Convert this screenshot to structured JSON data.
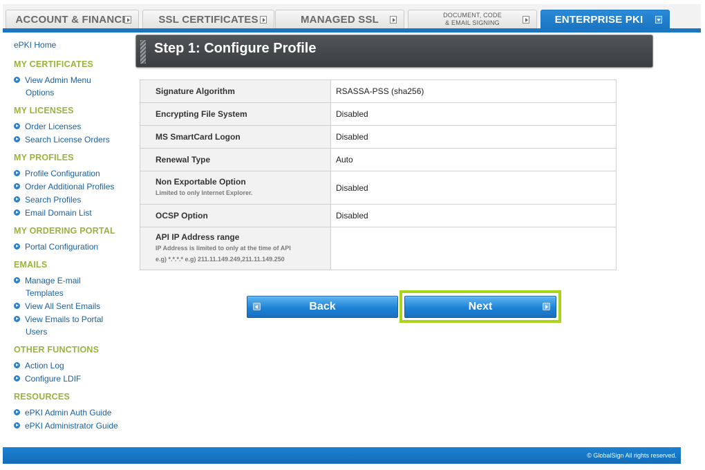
{
  "tabs": [
    {
      "label": "ACCOUNT & FINANCE",
      "active": false
    },
    {
      "label": "SSL CERTIFICATES",
      "active": false
    },
    {
      "label": "MANAGED SSL",
      "active": false
    },
    {
      "label_line1": "DOCUMENT, CODE",
      "label_line2": "& EMAIL SIGNING",
      "active": false
    },
    {
      "label": "ENTERPRISE PKI",
      "active": true
    }
  ],
  "sidebar": {
    "home": "ePKI Home",
    "sections": [
      {
        "title": "MY CERTIFICATES",
        "items": [
          {
            "l1": "View Admin Menu",
            "l2": "Options"
          }
        ]
      },
      {
        "title": "MY LICENSES",
        "items": [
          {
            "l1": "Order Licenses"
          },
          {
            "l1": "Search License Orders"
          }
        ]
      },
      {
        "title": "MY PROFILES",
        "items": [
          {
            "l1": "Profile Configuration"
          },
          {
            "l1": "Order Additional Profiles"
          },
          {
            "l1": "Search Profiles"
          },
          {
            "l1": "Email Domain List"
          }
        ]
      },
      {
        "title": "MY ORDERING PORTAL",
        "items": [
          {
            "l1": "Portal Configuration"
          }
        ]
      },
      {
        "title": "EMAILS",
        "items": [
          {
            "l1": "Manage E-mail",
            "l2": "Templates"
          },
          {
            "l1": "View All Sent Emails"
          },
          {
            "l1": "View Emails to Portal",
            "l2": "Users"
          }
        ]
      },
      {
        "title": "OTHER FUNCTIONS",
        "items": [
          {
            "l1": "Action Log"
          },
          {
            "l1": "Configure LDIF"
          }
        ]
      },
      {
        "title": "RESOURCES",
        "items": [
          {
            "l1": "ePKI Admin Auth Guide"
          },
          {
            "l1": "ePKI Administrator Guide"
          }
        ]
      }
    ]
  },
  "main": {
    "step_title": "Step 1: Configure Profile",
    "rows": [
      {
        "label": "Signature Algorithm",
        "value": "RSASSA-PSS (sha256)"
      },
      {
        "label": "Encrypting File System",
        "value": "Disabled"
      },
      {
        "label": "MS SmartCard Logon",
        "value": "Disabled"
      },
      {
        "label": "Renewal Type",
        "value": "Auto"
      },
      {
        "label": "Non Exportable Option",
        "note1": "Limited to only Internet Explorer.",
        "value": "Disabled"
      },
      {
        "label": "OCSP Option",
        "value": "Disabled"
      },
      {
        "label": "API IP Address range",
        "note1": "IP Address is limited to only at the time of API",
        "note2": "e.g) *.*.*.* e.g) 211.11.149.249,211.11.149.250",
        "value": ""
      }
    ],
    "back_label": "Back",
    "next_label": "Next"
  },
  "footer": {
    "copyright": "© GlobalSign All rights reserved."
  },
  "colors": {
    "accent": "#1a75c2",
    "section_title": "#97b53b",
    "highlight": "#a8d519",
    "link": "#1b5f9d"
  }
}
